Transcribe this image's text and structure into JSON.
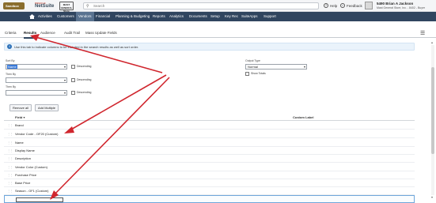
{
  "header": {
    "sandbox_label": "Sandbox",
    "oracle_label": "ORACLE",
    "netsuite_label": "NetSuite",
    "company_logo_text": "MAST GENERAL Store",
    "search_placeholder": "Search",
    "help_label": "Help",
    "feedback_label": "Feedback",
    "user_name": "5490 Brian A Jackson",
    "user_role": "Mast General Store, Inc. - 8402 - Buyer"
  },
  "nav": {
    "items": [
      {
        "label": "Activities"
      },
      {
        "label": "Customers"
      },
      {
        "label": "Vendors"
      },
      {
        "label": "Financial"
      },
      {
        "label": "Planning & Budgeting"
      },
      {
        "label": "Reports"
      },
      {
        "label": "Analytics"
      },
      {
        "label": "Documents"
      },
      {
        "label": "Setup"
      },
      {
        "label": "Key Rec"
      },
      {
        "label": "SuiteApps"
      },
      {
        "label": "Support"
      }
    ]
  },
  "tabs": [
    {
      "label": "Criteria"
    },
    {
      "label": "Results"
    },
    {
      "label": "Audience"
    },
    {
      "label": "Audit Trail"
    },
    {
      "label": "Mass Update Fields"
    }
  ],
  "info_text": "Use this tab to indicate columns to be included in the search results as well as sort order.",
  "form": {
    "sort_by_label": "Sort By",
    "sort_by_value": "Name",
    "descending_label": "Descending",
    "then_by_label_1": "Then By",
    "then_by_label_2": "Then By",
    "output_type_label": "Output Type",
    "output_type_value": "Normal",
    "show_totals_label": "Show Totals"
  },
  "buttons": {
    "remove_all": "Remove all",
    "add_multiple": "Add Multiple"
  },
  "grid": {
    "col_field": "Field",
    "col_custom_label": "Custom Label",
    "rows": [
      {
        "field": "Brand"
      },
      {
        "field": "Vendor Code - OF20 (Custom)"
      },
      {
        "field": "Name"
      },
      {
        "field": "Display Name"
      },
      {
        "field": "Description"
      },
      {
        "field": "Vendor Color (Custom)"
      },
      {
        "field": "Purchase Price"
      },
      {
        "field": "Base Price"
      },
      {
        "field": "Season - OF1 (Custom)"
      }
    ]
  },
  "annotation_color": "#d0262e",
  "colors": {
    "nav_bg": "#30455f",
    "accent": "#3879d9"
  }
}
